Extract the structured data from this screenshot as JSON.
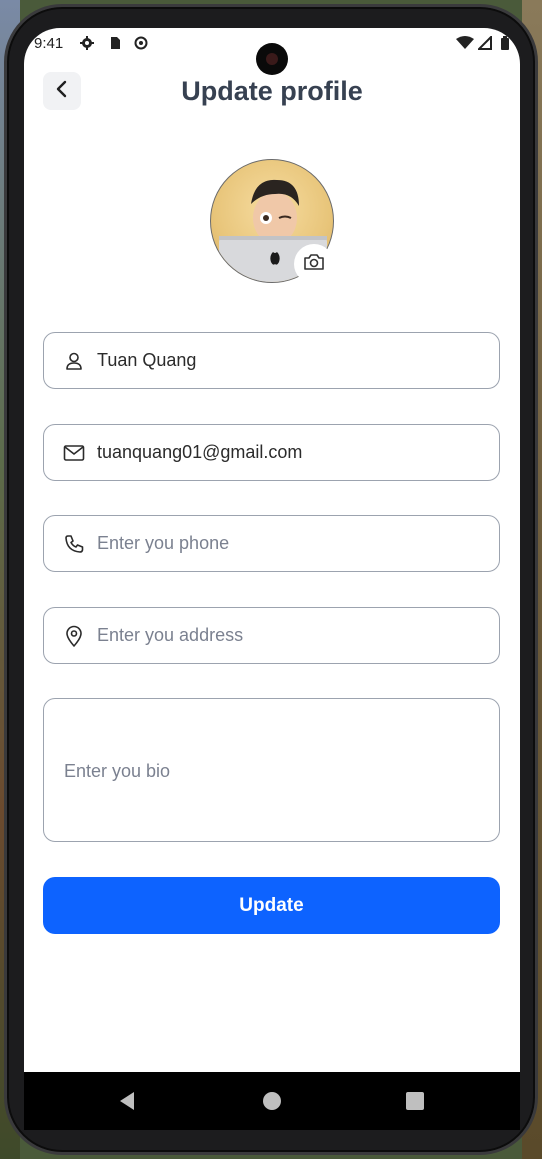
{
  "status_bar": {
    "time": "9:41",
    "icons": [
      "gear-icon",
      "sd-card-icon",
      "sync-icon",
      "wifi-icon",
      "signal-icon",
      "battery-icon"
    ]
  },
  "header": {
    "title": "Update profile",
    "back_icon": "chevron-left-icon"
  },
  "avatar": {
    "camera_icon": "camera-icon"
  },
  "form": {
    "name": {
      "value": "Tuan Quang",
      "icon": "user-icon"
    },
    "email": {
      "value": "tuanquang01@gmail.com",
      "icon": "mail-icon"
    },
    "phone": {
      "placeholder": "Enter you phone",
      "icon": "phone-icon"
    },
    "address": {
      "placeholder": "Enter you address",
      "icon": "location-pin-icon"
    },
    "bio": {
      "placeholder": "Enter you bio"
    }
  },
  "actions": {
    "update_label": "Update"
  },
  "nav": {
    "icons": [
      "back-triangle-icon",
      "home-circle-icon",
      "recents-square-icon"
    ]
  },
  "colors": {
    "accent": "#0d63ff",
    "title": "#374151",
    "border": "#9ca3af",
    "placeholder": "#7b8190"
  }
}
